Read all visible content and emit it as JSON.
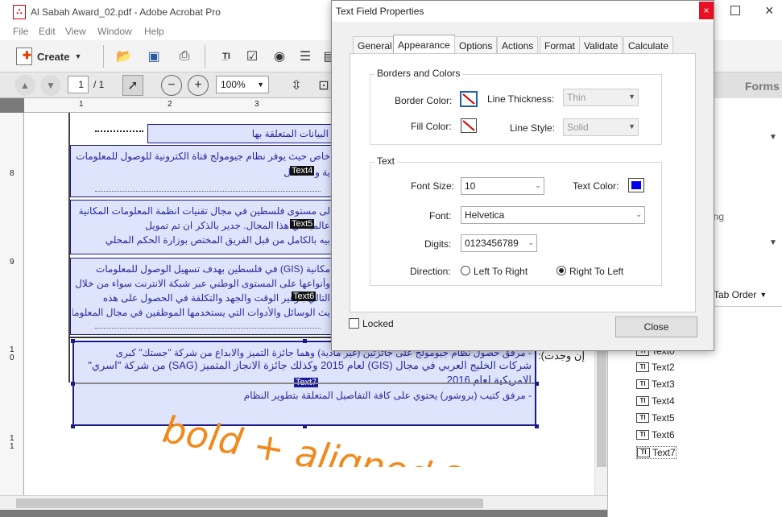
{
  "app": {
    "title": "Al Sabah Award_02.pdf - Adobe Acrobat Pro"
  },
  "menu": [
    "File",
    "Edit",
    "View",
    "Window",
    "Help"
  ],
  "toolbar": {
    "create_label": "Create",
    "page_current": "1",
    "page_total": "/ 1",
    "zoom": "100%"
  },
  "ruler": {
    "top_ticks": [
      "1",
      "2",
      "3"
    ],
    "left_ticks": [
      "8",
      "9",
      "1 0",
      "1 1"
    ]
  },
  "document": {
    "row1": "البيانات المتعلقة بها",
    "row2_line1": "خاص حيث يوفر نظام جيومولج قناة الكترونية للوصول للمعلومات",
    "row2_line2": "ية والاكتمال",
    "row3_line1": "لى مستوى فلسطين في مجال تقنيات انظمة المعلومات المكانية",
    "row3_line2": "عالمياً في هذا المجال. جدير بالذكر ان تم تمويل",
    "row3_line3": "بيه بالكامل من قبل الفريق المختص بوزارة الحكم المحلي",
    "row4_line1": "مكانية (GIS) في فلسطين بهدف تسهيل الوصول للمعلومات",
    "row4_line2": "وأنواعها على المستوى الوطني عبر شبكة الانترنت سواء من خلال",
    "row4_line3": "التالي بتوفير الوقت والجهد والتكلفة في الحصول على هذه",
    "row4_line4": "يث الوسائل والأدوات التي يستخدمها الموظفين في مجال المعلومات",
    "row5_line1": "- مرفق حصول نظام جيومولج على جائزتين (غير مادية) وهما جائزة التميز والابداع من شركة \"جستك\" كبرى",
    "row5_line2": "شركات الخليج العربي في مجال (GIS) لعام 2015 وكذلك جائزة الانجاز المتميز (SAG) من شركة \"اسري\"",
    "row5_line3": "الامريكية لعام 2016",
    "row5_line4": "- مرفق كتيب (بروشور) يحتوي على كافة التفاصيل المتعلقة بتطوير النظام",
    "outside_label": "إن وجدت):",
    "tags": [
      "Text4",
      "Text5",
      "Text6",
      "Text7"
    ]
  },
  "annotation": "bold + aligned ??",
  "right_panel": {
    "title": "Forms",
    "partial_label": "ing",
    "tab_order": "Tab Order",
    "fields": [
      "Text0",
      "Text2",
      "Text3",
      "Text4",
      "Text5",
      "Text6",
      "Text7"
    ]
  },
  "dialog": {
    "title": "Text Field Properties",
    "close_x": "×",
    "tabs": [
      "General",
      "Appearance",
      "Options",
      "Actions",
      "Format",
      "Validate",
      "Calculate"
    ],
    "active_tab": "Appearance",
    "borders_group": "Borders and Colors",
    "border_color_label": "Border Color:",
    "fill_color_label": "Fill Color:",
    "line_thickness_label": "Line Thickness:",
    "line_thickness_value": "Thin",
    "line_style_label": "Line Style:",
    "line_style_value": "Solid",
    "text_group": "Text",
    "font_size_label": "Font Size:",
    "font_size_value": "10",
    "text_color_label": "Text Color:",
    "text_color": "#0000ee",
    "font_label": "Font:",
    "font_value": "Helvetica",
    "digits_label": "Digits:",
    "digits_value": "0123456789",
    "direction_label": "Direction:",
    "ltr_label": "Left To Right",
    "rtl_label": "Right To Left",
    "direction_selected": "Right To Left",
    "locked_label": "Locked",
    "close_button": "Close"
  },
  "colors": {
    "annotation": "#f08a1c",
    "field_fill": "#dde4fb",
    "field_border": "#1a1a8a"
  }
}
